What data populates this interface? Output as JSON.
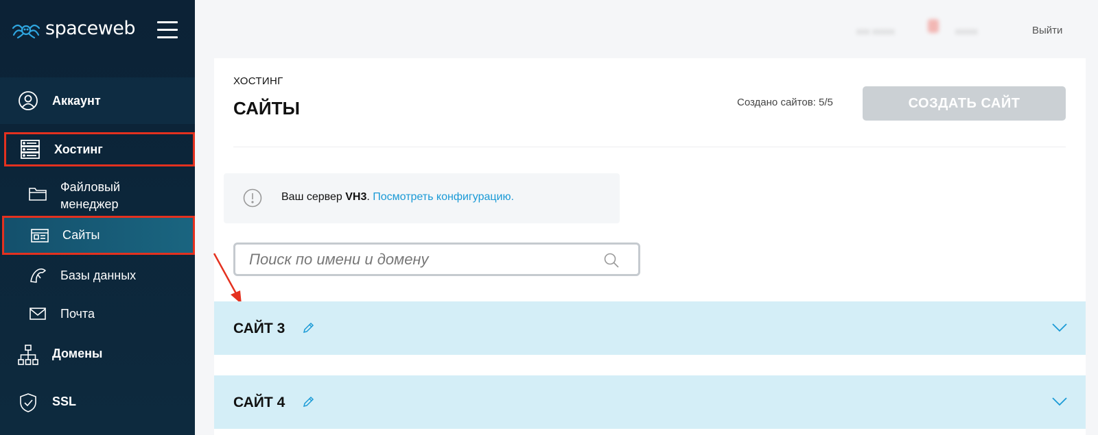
{
  "sidebar": {
    "logo_text": "spaceweb",
    "nav": {
      "account": "Аккаунт",
      "hosting": "Хостинг",
      "domains": "Домены",
      "ssl": "SSL"
    },
    "sub": {
      "files_line1": "Файловый",
      "files_line2": "менеджер",
      "sites": "Сайты",
      "databases": "Базы данных",
      "mail": "Почта"
    }
  },
  "topbar": {
    "blurred_1": "ххх ххххх",
    "blurred_2": "ххххх",
    "logout": "Выйти"
  },
  "main": {
    "breadcrumb": "ХОСТИНГ",
    "title": "САЙТЫ",
    "created_count": "Создано сайтов: 5/5",
    "create_button": "СОЗДАТЬ САЙТ",
    "notice": {
      "prefix": "Ваш сервер ",
      "server": "VH3",
      "dot": ".",
      "link": "Посмотреть конфигурацию."
    },
    "search_placeholder": "Поиск по имени и домену",
    "sites": [
      {
        "name": "САЙТ 3"
      },
      {
        "name": "САЙТ 4"
      }
    ]
  },
  "colors": {
    "sidebar_bg": "#0c2236",
    "highlight": "#e4311f",
    "link": "#1a9ad6",
    "site_row_bg": "#d4eef7",
    "button_disabled": "#cbd0d4"
  }
}
